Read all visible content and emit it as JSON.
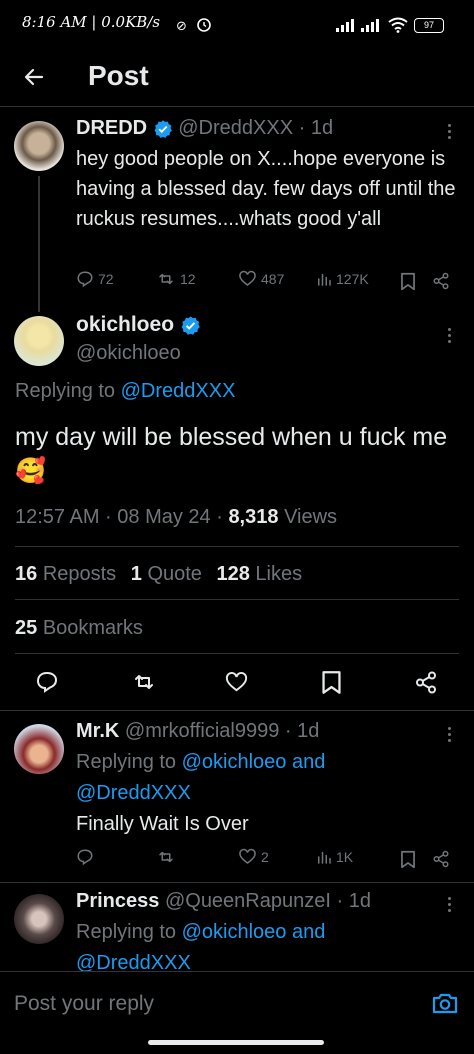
{
  "status_bar": {
    "time": "8:16 AM | 0.0KB/s",
    "battery": "97"
  },
  "header": {
    "title": "Post"
  },
  "parent_tweet": {
    "name": "DREDD",
    "handle": "@DreddXXX",
    "time": "· 1d",
    "text": "hey good people on X....hope everyone is having a blessed day. few days off until the ruckus resumes....whats good y'all",
    "replies": "72",
    "reposts": "12",
    "likes": "487",
    "views": "127K"
  },
  "main_tweet": {
    "name": "okichloeo",
    "handle": "@okichloeo",
    "replying_prefix": "Replying to",
    "replying_to": "@DreddXXX",
    "text": "my day will be blessed when u fuck me",
    "emoji": "🥰",
    "timestamp": "12:57 AM · 08 May 24 · ",
    "views_count": "8,318",
    "views_label": "Views",
    "reposts_count": "16",
    "reposts_label": "Reposts",
    "quotes_count": "1",
    "quotes_label": "Quote",
    "likes_count": "128",
    "likes_label": "Likes",
    "bookmarks_count": "25",
    "bookmarks_label": "Bookmarks"
  },
  "replies": [
    {
      "name": "Mr.K",
      "handle": "@mrkofficial9999",
      "time": "· 1d",
      "replying_prefix": "Replying to",
      "replying_to_1": "@okichloeo",
      "replying_and": "and",
      "replying_to_2": "@DreddXXX",
      "text": "Finally Wait Is Over",
      "replies": "",
      "reposts": "",
      "likes": "2",
      "views": "1K"
    },
    {
      "name": "Princess",
      "handle": "@QueenRapunzeI",
      "time": "· 1d",
      "replying_prefix": "Replying to",
      "replying_to_1": "@okichloeo",
      "replying_and": "and",
      "replying_to_2": "@DreddXXX"
    }
  ],
  "composer": {
    "placeholder": "Post your reply"
  },
  "colors": {
    "accent": "#1d9bf0",
    "background": "#000000",
    "text": "#e7e9ea",
    "muted": "#71767b",
    "border": "#2f3336"
  }
}
